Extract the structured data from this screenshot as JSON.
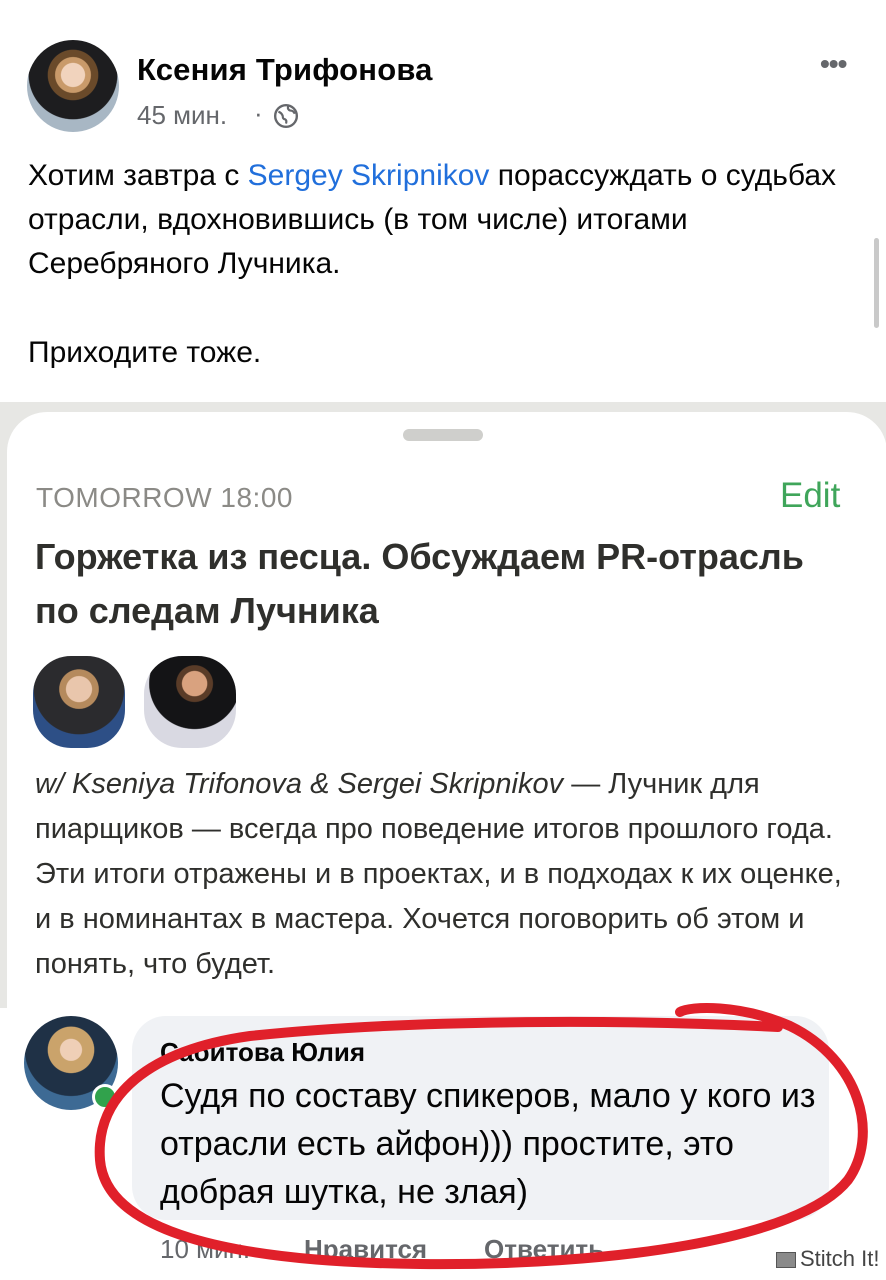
{
  "post": {
    "author": "Ксения Трифонова",
    "time": "45 мин.",
    "separator": "·",
    "more": "•••",
    "text_before": "Хотим завтра с ",
    "mention": "Sergey Skripnikov",
    "text_after": " порассуждать о судьбах отрасли, вдохновившись (в том числе) итогами Серебряного Лучника.",
    "cta": "Приходите тоже."
  },
  "event": {
    "when": "TOMORROW 18:00",
    "edit": "Edit",
    "title": "Горжетка из песца. Обсуждаем PR-отрасль по следам Лучника",
    "with": "w/ Kseniya Trifonova & Sergei Skripnikov",
    "description": " — Лучник для пиарщиков — всегда про поведение итогов прошлого года. Эти итоги отражены и в проектах, и в подходах к их оценке, и в номинантах в мастера. Хочется поговорить об этом и понять, что будет."
  },
  "comment": {
    "author": "Сабитова Юлия",
    "text": "Судя по составу спикеров, мало у кого из отрасли есть айфон))) простите, это добрая шутка, не злая)",
    "time": "10 мин.",
    "like": "Нравится",
    "reply": "Ответить"
  },
  "watermark": "Stitch It!",
  "colors": {
    "mention": "#216fdb",
    "edit": "#3fa55a",
    "highlight_circle": "#e0202a"
  },
  "icons": {
    "privacy": "globe-icon",
    "more": "more-dots-icon"
  }
}
